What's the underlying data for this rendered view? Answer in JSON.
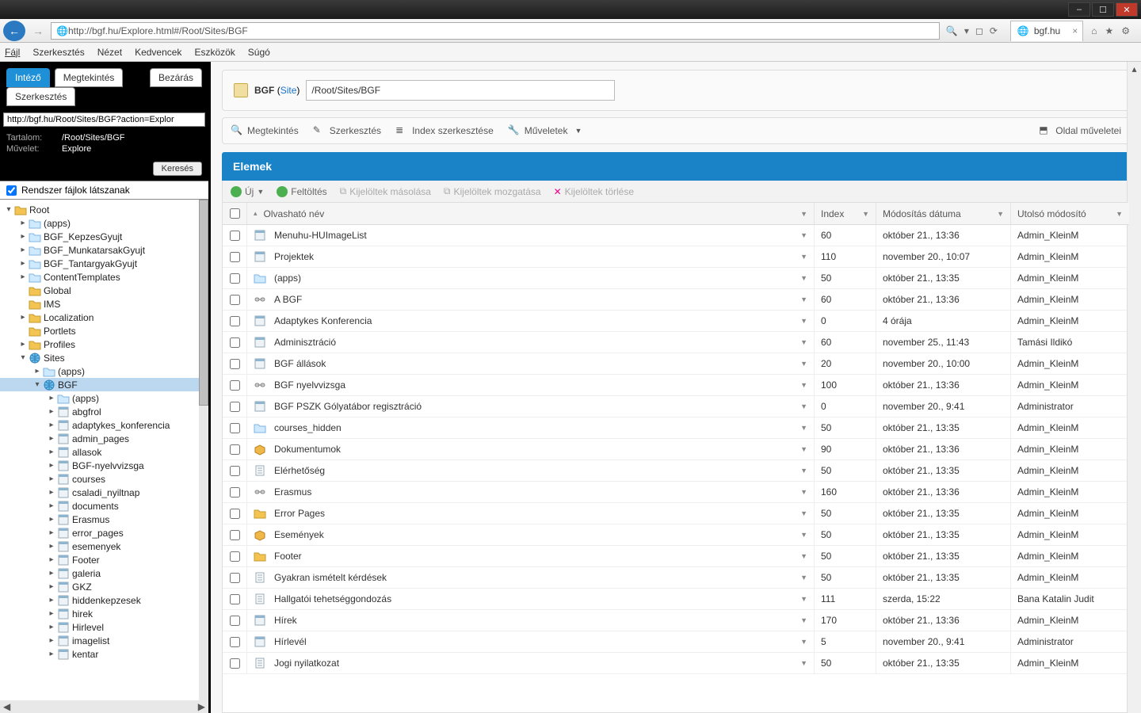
{
  "window": {
    "min": "–",
    "max": "☐",
    "close": "✕"
  },
  "browser": {
    "url": "http://bgf.hu/Explore.html#/Root/Sites/BGF",
    "tab_label": "bgf.hu",
    "home_icon": "⌂",
    "star_icon": "★",
    "gear_icon": "⚙",
    "search_icon": "🔍",
    "refresh_icon": "⟳"
  },
  "menu": {
    "items": [
      "Fájl",
      "Szerkesztés",
      "Nézet",
      "Kedvencek",
      "Eszközök",
      "Súgó"
    ]
  },
  "sidebar": {
    "tabs": {
      "explore": "Intéző",
      "view": "Megtekintés",
      "close": "Bezárás",
      "edit": "Szerkesztés"
    },
    "url": "http://bgf.hu/Root/Sites/BGF?action=Explor",
    "meta": {
      "content_lbl": "Tartalom:",
      "content_val": "/Root/Sites/BGF",
      "action_lbl": "Művelet:",
      "action_val": "Explore"
    },
    "search_btn": "Keresés",
    "sysfiles": "Rendszer fájlok látszanak",
    "tree": [
      {
        "d": 0,
        "tw": "▾",
        "t": "fld",
        "l": "Root"
      },
      {
        "d": 1,
        "tw": "▸",
        "t": "fldb",
        "l": "(apps)"
      },
      {
        "d": 1,
        "tw": "▸",
        "t": "fldb",
        "l": "BGF_KepzesGyujt"
      },
      {
        "d": 1,
        "tw": "▸",
        "t": "fldb",
        "l": "BGF_MunkatarsakGyujt"
      },
      {
        "d": 1,
        "tw": "▸",
        "t": "fldb",
        "l": "BGF_TantargyakGyujt"
      },
      {
        "d": 1,
        "tw": "▸",
        "t": "fldb",
        "l": "ContentTemplates"
      },
      {
        "d": 1,
        "tw": "",
        "t": "fld",
        "l": "Global"
      },
      {
        "d": 1,
        "tw": "",
        "t": "fld",
        "l": "IMS"
      },
      {
        "d": 1,
        "tw": "▸",
        "t": "fld",
        "l": "Localization"
      },
      {
        "d": 1,
        "tw": "",
        "t": "fld",
        "l": "Portlets"
      },
      {
        "d": 1,
        "tw": "▸",
        "t": "fld",
        "l": "Profiles"
      },
      {
        "d": 1,
        "tw": "▾",
        "t": "globe",
        "l": "Sites"
      },
      {
        "d": 2,
        "tw": "▸",
        "t": "fldb",
        "l": "(apps)"
      },
      {
        "d": 2,
        "tw": "▾",
        "t": "globe",
        "l": "BGF",
        "sel": true
      },
      {
        "d": 3,
        "tw": "▸",
        "t": "fldb",
        "l": "(apps)"
      },
      {
        "d": 3,
        "tw": "▸",
        "t": "pg",
        "l": "abgfrol"
      },
      {
        "d": 3,
        "tw": "▸",
        "t": "pg",
        "l": "adaptykes_konferencia"
      },
      {
        "d": 3,
        "tw": "▸",
        "t": "pg",
        "l": "admin_pages"
      },
      {
        "d": 3,
        "tw": "▸",
        "t": "pg",
        "l": "allasok"
      },
      {
        "d": 3,
        "tw": "▸",
        "t": "pg",
        "l": "BGF-nyelvvizsga"
      },
      {
        "d": 3,
        "tw": "▸",
        "t": "pg",
        "l": "courses"
      },
      {
        "d": 3,
        "tw": "▸",
        "t": "pg",
        "l": "csaladi_nyiltnap"
      },
      {
        "d": 3,
        "tw": "▸",
        "t": "pg",
        "l": "documents"
      },
      {
        "d": 3,
        "tw": "▸",
        "t": "pg",
        "l": "Erasmus"
      },
      {
        "d": 3,
        "tw": "▸",
        "t": "pg",
        "l": "error_pages"
      },
      {
        "d": 3,
        "tw": "▸",
        "t": "pg",
        "l": "esemenyek"
      },
      {
        "d": 3,
        "tw": "▸",
        "t": "pg",
        "l": "Footer"
      },
      {
        "d": 3,
        "tw": "▸",
        "t": "pg",
        "l": "galeria"
      },
      {
        "d": 3,
        "tw": "▸",
        "t": "pg",
        "l": "GKZ"
      },
      {
        "d": 3,
        "tw": "▸",
        "t": "pg",
        "l": "hiddenkepzesek"
      },
      {
        "d": 3,
        "tw": "▸",
        "t": "pg",
        "l": "hirek"
      },
      {
        "d": 3,
        "tw": "▸",
        "t": "pg",
        "l": "Hirlevel"
      },
      {
        "d": 3,
        "tw": "▸",
        "t": "pg",
        "l": "imagelist"
      },
      {
        "d": 3,
        "tw": "▸",
        "t": "pg",
        "l": "kentar"
      }
    ]
  },
  "content": {
    "crumb_title": "BGF",
    "crumb_type": "Site",
    "path": "/Root/Sites/BGF",
    "toolbar": {
      "view": "Megtekintés",
      "edit": "Szerkesztés",
      "idx": "Index szerkesztése",
      "ops": "Műveletek",
      "page": "Oldal műveletei"
    },
    "section": "Elemek",
    "actions": {
      "new": "Új",
      "upload": "Feltöltés",
      "copy": "Kijelöltek másolása",
      "move": "Kijelöltek mozgatása",
      "del": "Kijelöltek törlése"
    },
    "columns": {
      "name": "Olvasható név",
      "idx": "Index",
      "date": "Módosítás dátuma",
      "user": "Utolsó módosító"
    },
    "rows": [
      {
        "ic": "pg",
        "n": "Menuhu-HUImageList",
        "i": "60",
        "d": "október 21., 13:36",
        "u": "Admin_KleinM"
      },
      {
        "ic": "pg",
        "n": "Projektek",
        "i": "110",
        "d": "november 20., 10:07",
        "u": "Admin_KleinM"
      },
      {
        "ic": "fldb",
        "n": "(apps)",
        "i": "50",
        "d": "október 21., 13:35",
        "u": "Admin_KleinM"
      },
      {
        "ic": "link",
        "n": "A BGF",
        "i": "60",
        "d": "október 21., 13:36",
        "u": "Admin_KleinM"
      },
      {
        "ic": "pg",
        "n": "Adaptykes Konferencia",
        "i": "0",
        "d": "4 órája",
        "u": "Admin_KleinM"
      },
      {
        "ic": "pg",
        "n": "Adminisztráció",
        "i": "60",
        "d": "november 25., 11:43",
        "u": "Tamási Ildikó"
      },
      {
        "ic": "pg",
        "n": "BGF állások",
        "i": "20",
        "d": "november 20., 10:00",
        "u": "Admin_KleinM"
      },
      {
        "ic": "link",
        "n": "BGF nyelvvizsga",
        "i": "100",
        "d": "október 21., 13:36",
        "u": "Admin_KleinM"
      },
      {
        "ic": "pg",
        "n": "BGF PSZK Gólyatábor regisztráció",
        "i": "0",
        "d": "november 20., 9:41",
        "u": "Administrator"
      },
      {
        "ic": "fldb",
        "n": "courses_hidden",
        "i": "50",
        "d": "október 21., 13:35",
        "u": "Admin_KleinM"
      },
      {
        "ic": "box",
        "n": "Dokumentumok",
        "i": "90",
        "d": "október 21., 13:36",
        "u": "Admin_KleinM"
      },
      {
        "ic": "doc",
        "n": "Elérhetőség",
        "i": "50",
        "d": "október 21., 13:35",
        "u": "Admin_KleinM"
      },
      {
        "ic": "link",
        "n": "Erasmus",
        "i": "160",
        "d": "október 21., 13:36",
        "u": "Admin_KleinM"
      },
      {
        "ic": "fld",
        "n": "Error Pages",
        "i": "50",
        "d": "október 21., 13:35",
        "u": "Admin_KleinM"
      },
      {
        "ic": "box",
        "n": "Események",
        "i": "50",
        "d": "október 21., 13:35",
        "u": "Admin_KleinM"
      },
      {
        "ic": "fld",
        "n": "Footer",
        "i": "50",
        "d": "október 21., 13:35",
        "u": "Admin_KleinM"
      },
      {
        "ic": "doc",
        "n": "Gyakran ismételt kérdések",
        "i": "50",
        "d": "október 21., 13:35",
        "u": "Admin_KleinM"
      },
      {
        "ic": "doc",
        "n": "Hallgatói tehetséggondozás",
        "i": "111",
        "d": "szerda, 15:22",
        "u": "Bana Katalin Judit"
      },
      {
        "ic": "pg",
        "n": "Hírek",
        "i": "170",
        "d": "október 21., 13:36",
        "u": "Admin_KleinM"
      },
      {
        "ic": "pg",
        "n": "Hírlevél",
        "i": "5",
        "d": "november 20., 9:41",
        "u": "Administrator"
      },
      {
        "ic": "doc",
        "n": "Jogi nyilatkozat",
        "i": "50",
        "d": "október 21., 13:35",
        "u": "Admin_KleinM"
      }
    ]
  }
}
